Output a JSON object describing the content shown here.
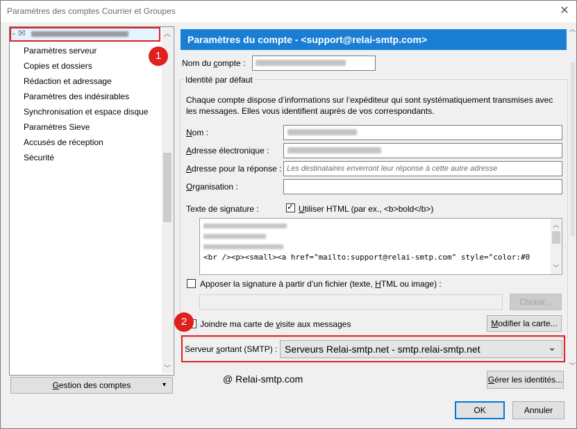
{
  "window": {
    "title": "Paramètres des comptes Courrier et Groupes",
    "close_glyph": "✕"
  },
  "sidebar": {
    "account_glyph": "✉",
    "items": [
      {
        "label": "Paramètres serveur"
      },
      {
        "label": "Copies et dossiers"
      },
      {
        "label": "Rédaction et adressage"
      },
      {
        "label": "Paramètres des indésirables"
      },
      {
        "label": "Synchronisation et espace disque"
      },
      {
        "label": "Paramètres Sieve"
      },
      {
        "label": "Accusés de réception"
      },
      {
        "label": "Sécurité"
      }
    ],
    "manage_button": {
      "label_u": "G",
      "label_rest": "estion des comptes",
      "arrow": "▾"
    }
  },
  "header": {
    "title": "Paramètres du compte - <support@relai-smtp.com>"
  },
  "account_name": {
    "label_pre": "Nom du ",
    "label_u": "c",
    "label_post": "ompte :"
  },
  "identity": {
    "legend": "Identité par défaut",
    "description": "Chaque compte dispose d’informations sur l’expéditeur qui sont systématiquement transmises avec les messages. Elles vous identifient auprès de vos correspondants.",
    "name_label": {
      "u": "N",
      "rest": "om :"
    },
    "email_label": {
      "u": "A",
      "rest": "dresse électronique :"
    },
    "reply_label": {
      "u": "A",
      "rest": "dresse pour la réponse :"
    },
    "reply_placeholder": "Les destinataires enverront leur réponse à cette autre adresse",
    "org_label": {
      "u": "O",
      "rest": "rganisation :"
    },
    "signature_label": "Texte de signature :",
    "html_checkbox": {
      "checked": true,
      "u": "U",
      "rest": "tiliser HTML (par ex., <b>bold</b>)"
    },
    "signature_code": "<br /><p><small><a href=\"mailto:support@relai-smtp.com\" style=\"color:#0",
    "file_signature": {
      "pre": "Apposer la signature à partir d’un fichier (texte, ",
      "u": "H",
      "post": "TML ou image) :"
    },
    "choose_button": "Choisir...",
    "vcard": {
      "pre": "Joindre ma carte de ",
      "u": "v",
      "post": "isite aux messages"
    },
    "edit_card_button": {
      "u": "M",
      "rest": "odifier la carte..."
    }
  },
  "smtp": {
    "label_pre": "Serveur ",
    "label_u": "s",
    "label_post": "ortant (SMTP) :",
    "value": "Serveurs Relai-smtp.net - smtp.relai-smtp.net",
    "arrow": "⌄"
  },
  "manage_identities": {
    "u": "G",
    "rest": "érer les identités..."
  },
  "watermark": "@ Relai-smtp.com",
  "badges": [
    "1",
    "2"
  ],
  "footer": {
    "ok": "OK",
    "cancel": "Annuler"
  },
  "colors": {
    "accent": "#1a7fd4",
    "annotation": "#e01e1e"
  }
}
